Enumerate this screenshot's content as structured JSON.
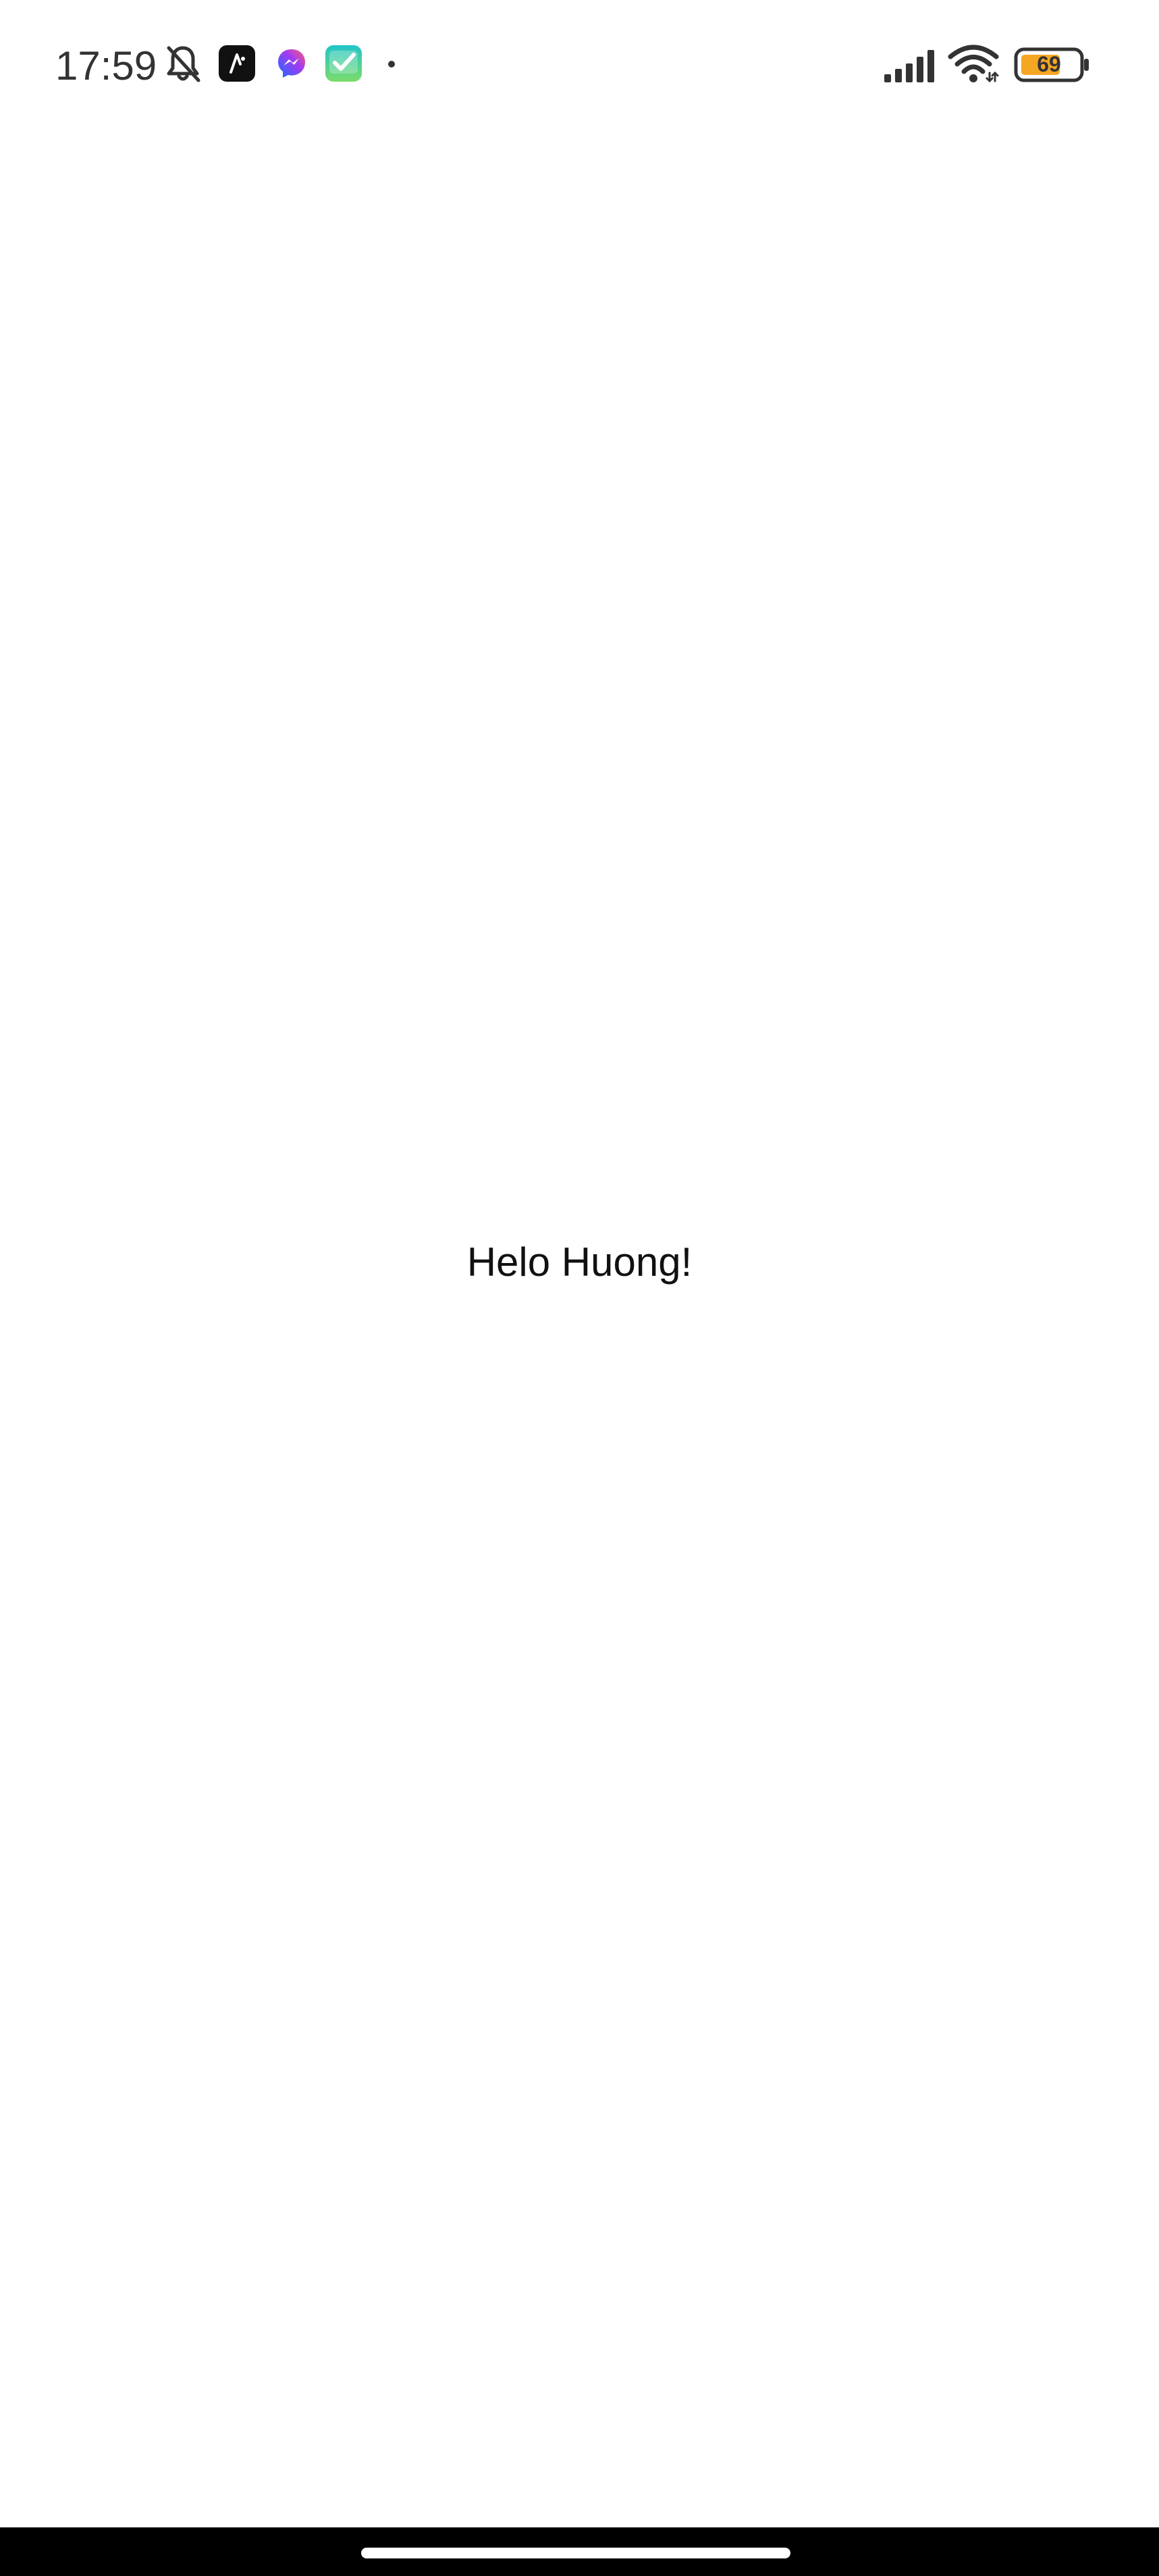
{
  "status_bar": {
    "time": "17:59",
    "battery_level": "69",
    "notification_icons": [
      "bell-muted-icon",
      "app-black-icon",
      "messenger-icon",
      "teal-check-app-icon",
      "dot-icon"
    ],
    "right_icons": [
      "signal-icon",
      "wifi-icon",
      "battery-icon"
    ],
    "battery_color": "#f5a623"
  },
  "main": {
    "greeting": "Helo Huong!"
  },
  "nav_bar": {
    "handle_icon": "home-handle"
  }
}
